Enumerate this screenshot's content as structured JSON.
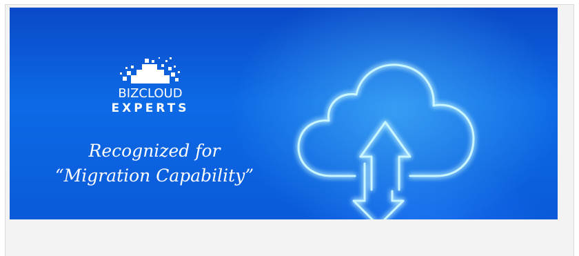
{
  "banner": {
    "logo": {
      "line1": "BIZCLOUD",
      "line2": "EXPERTS"
    },
    "tagline": {
      "line1": "Recognized for",
      "line2": "“Migration Capability”"
    },
    "icon": "cloud-upload-download-icon",
    "colors": {
      "background": "#0d6ae6",
      "glow": "#bff4ff",
      "text": "#ffffff"
    }
  }
}
